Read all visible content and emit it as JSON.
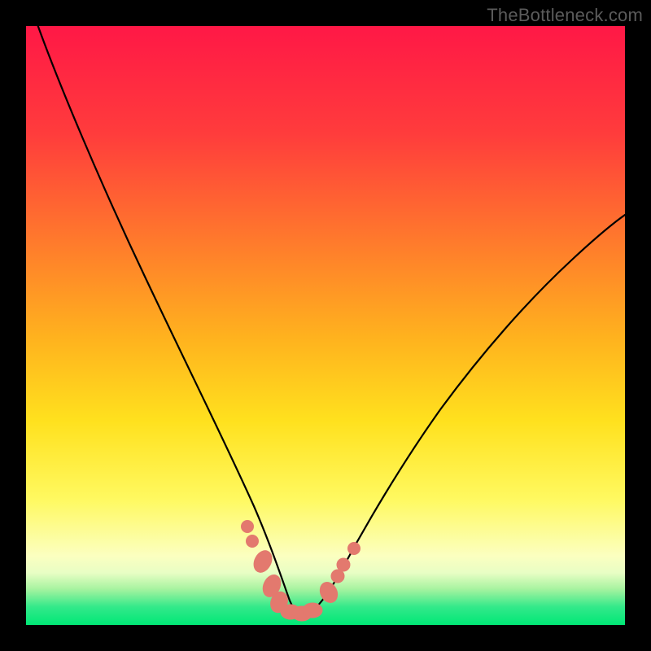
{
  "watermark": "TheBottleneck.com",
  "chart_data": {
    "type": "line",
    "title": "",
    "xlabel": "",
    "ylabel": "",
    "xlim": [
      0,
      100
    ],
    "ylim": [
      0,
      100
    ],
    "grid": false,
    "series": [
      {
        "name": "response-curve",
        "x": [
          2,
          5,
          10,
          15,
          20,
          25,
          30,
          33,
          36,
          38,
          40,
          41.5,
          43,
          44.5,
          46,
          48,
          50,
          52,
          55,
          60,
          65,
          70,
          75,
          80,
          85,
          90,
          95,
          100
        ],
        "y": [
          100,
          92,
          79,
          67,
          55,
          44,
          33,
          26,
          19,
          13,
          8,
          5,
          3,
          2,
          2,
          3,
          5,
          8,
          13,
          22,
          30,
          37,
          43,
          49,
          54,
          58,
          62,
          66
        ]
      }
    ],
    "threshold_bands": [
      {
        "name": "green-band",
        "y_range": [
          0,
          3.3
        ],
        "color": "#00e776"
      },
      {
        "name": "yellow-green-band",
        "y_range": [
          3.3,
          8
        ],
        "color_top": "#f6fdbd",
        "color_bottom": "#9af29a"
      }
    ],
    "markers": [
      {
        "name": "left-cluster-top-dot",
        "x": 37.0,
        "y": 16.5,
        "r": 1.0
      },
      {
        "name": "left-cluster-dot-2",
        "x": 37.8,
        "y": 14.0,
        "r": 1.0
      },
      {
        "name": "left-cluster-pill-1",
        "x": 39.5,
        "y": 10.5,
        "r": 1.6,
        "elongated": true
      },
      {
        "name": "left-cluster-pill-2",
        "x": 41.0,
        "y": 6.5,
        "r": 1.6,
        "elongated": true
      },
      {
        "name": "left-cluster-pill-3",
        "x": 42.3,
        "y": 3.8,
        "r": 1.6,
        "elongated": true
      },
      {
        "name": "bottom-pill-1",
        "x": 44.2,
        "y": 2.2,
        "r": 1.4
      },
      {
        "name": "bottom-pill-2",
        "x": 46.0,
        "y": 2.0,
        "r": 1.4
      },
      {
        "name": "bottom-pill-3",
        "x": 47.8,
        "y": 2.4,
        "r": 1.4
      },
      {
        "name": "right-cluster-pill-1",
        "x": 50.5,
        "y": 5.5,
        "r": 1.6,
        "elongated": true
      },
      {
        "name": "right-cluster-dot-1",
        "x": 52.0,
        "y": 8.2,
        "r": 1.1
      },
      {
        "name": "right-cluster-dot-2",
        "x": 53.0,
        "y": 10.0,
        "r": 1.1
      },
      {
        "name": "right-cluster-top-dot",
        "x": 54.8,
        "y": 12.8,
        "r": 1.0
      }
    ],
    "marker_color": "#e3796e",
    "background_gradient": {
      "type": "linear-vertical",
      "stops": [
        {
          "pos": 0.0,
          "color": "#ff1846"
        },
        {
          "pos": 0.18,
          "color": "#ff3c3c"
        },
        {
          "pos": 0.36,
          "color": "#ff7a2c"
        },
        {
          "pos": 0.52,
          "color": "#ffb21e"
        },
        {
          "pos": 0.66,
          "color": "#ffe11e"
        },
        {
          "pos": 0.79,
          "color": "#fff960"
        },
        {
          "pos": 0.885,
          "color": "#fbffc0"
        },
        {
          "pos": 0.913,
          "color": "#e8fec4"
        },
        {
          "pos": 0.94,
          "color": "#a7f3a0"
        },
        {
          "pos": 0.97,
          "color": "#33e98a"
        },
        {
          "pos": 1.0,
          "color": "#00e776"
        }
      ]
    }
  }
}
